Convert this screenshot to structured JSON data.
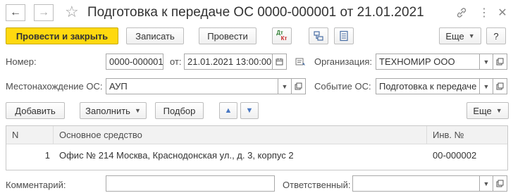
{
  "header": {
    "back_icon": "←",
    "forward_icon": "→",
    "star_icon": "☆",
    "title": "Подготовка к передаче ОС 0000-000001 от 21.01.2021",
    "link_icon": "🔗",
    "more_icon": "⋮",
    "close_icon": "✕"
  },
  "toolbar": {
    "post_close": "Провести и закрыть",
    "save": "Записать",
    "post": "Провести",
    "dtkt_top": "Дт",
    "dtkt_bottom": "Кт",
    "more": "Еще",
    "help": "?"
  },
  "form": {
    "number_label": "Номер:",
    "number_value": "0000-000001",
    "date_label": "от:",
    "date_value": "21.01.2021 13:00:00",
    "org_label": "Организация:",
    "org_value": "ТЕХНОМИР ООО",
    "location_label": "Местонахождение ОС:",
    "location_value": "АУП",
    "event_label": "Событие ОС:",
    "event_value": "Подготовка к передаче",
    "comment_label": "Комментарий:",
    "comment_value": "",
    "responsible_label": "Ответственный:",
    "responsible_value": ""
  },
  "table_toolbar": {
    "add": "Добавить",
    "fill": "Заполнить",
    "select": "Подбор",
    "up_icon": "▲",
    "down_icon": "▼",
    "more": "Еще"
  },
  "table": {
    "columns": [
      "N",
      "Основное средство",
      "Инв. №"
    ],
    "rows": [
      {
        "n": "1",
        "asset": "Офис № 214 Москва, Краснодонская ул., д. 3, корпус 2",
        "inv": "00-000002"
      }
    ]
  },
  "colors": {
    "primary_button": "#ffd90f",
    "border": "#a9a9a9",
    "table_header": "#f2f2f2"
  }
}
